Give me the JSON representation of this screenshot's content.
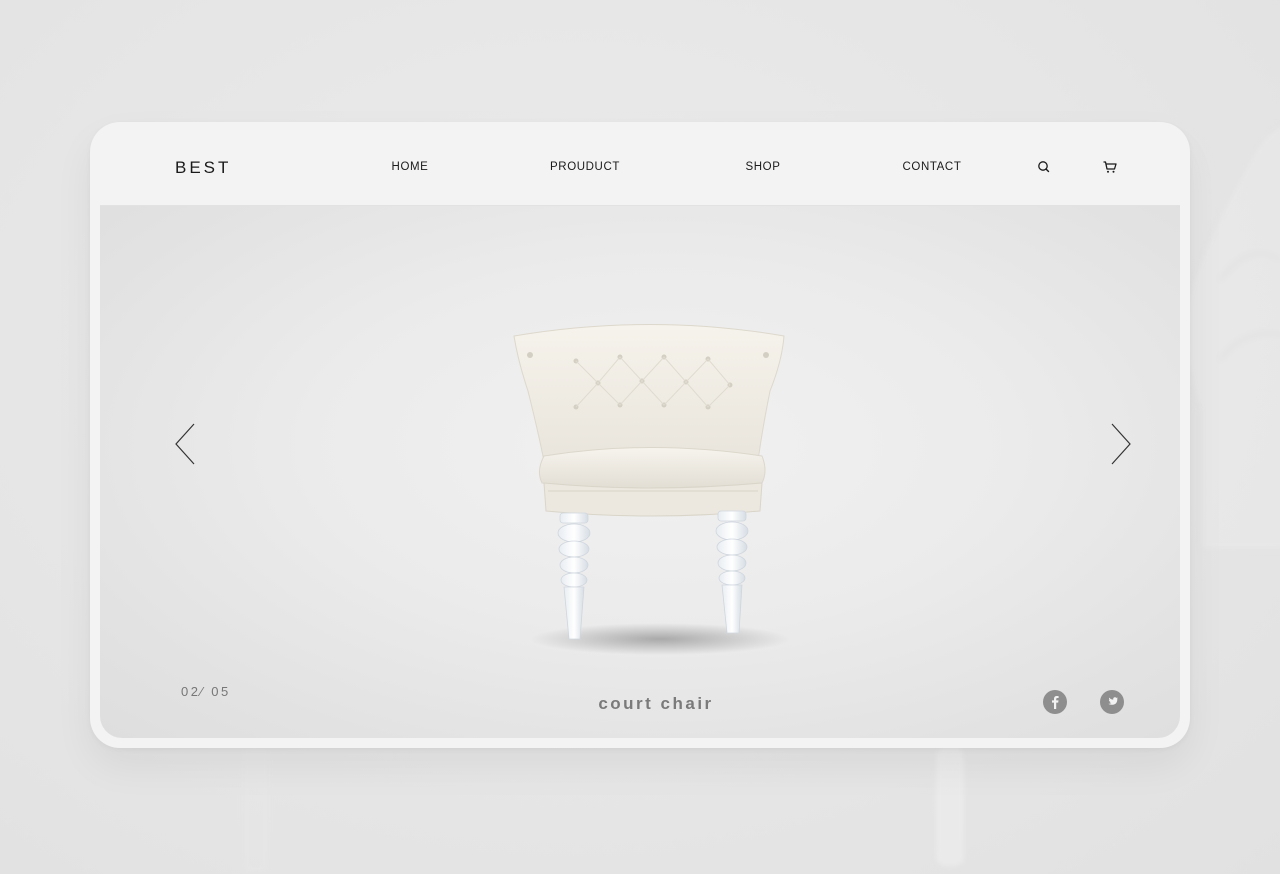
{
  "brand": {
    "logo": "BEST"
  },
  "nav": {
    "items": [
      {
        "label": "HOME"
      },
      {
        "label": "PROUDUCT"
      },
      {
        "label": "SHOP"
      },
      {
        "label": "CONTACT"
      }
    ],
    "icons": [
      "search-icon",
      "cart-icon"
    ]
  },
  "hero": {
    "product_name": "court chair",
    "counter": "02⁄ 05",
    "prev_icon": "chevron-left-icon",
    "next_icon": "chevron-right-icon"
  },
  "social": {
    "icons": [
      "facebook-icon",
      "twitter-icon"
    ]
  },
  "colors": {
    "page_bg": "#e6e6e6",
    "card_bg": "#f3f3f3",
    "text": "#1a1a1a",
    "muted_text": "#7a7a7a",
    "social_bg": "#8e8e8e"
  }
}
